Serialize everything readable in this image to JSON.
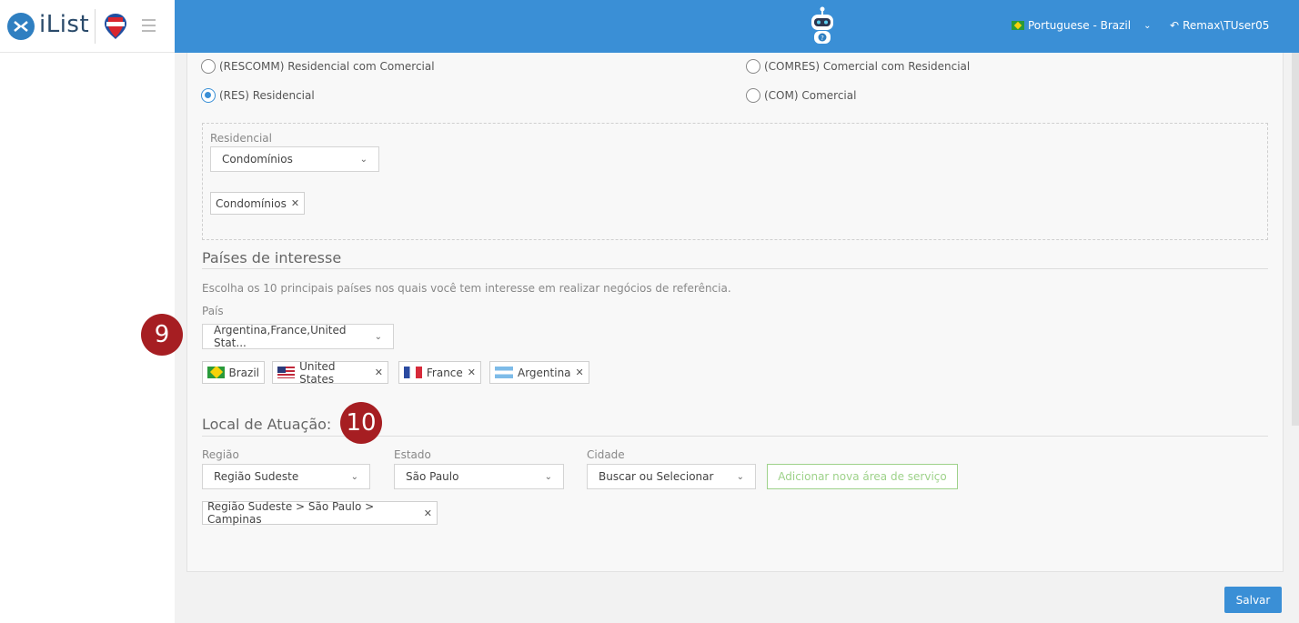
{
  "header": {
    "app_name": "iList",
    "language": "Portuguese - Brazil",
    "user": "Remax\\TUser05"
  },
  "property_types": [
    {
      "label": "(RESCOMM) Residencial com Comercial",
      "checked": false
    },
    {
      "label": "(COMRES) Comercial com Residencial",
      "checked": false
    },
    {
      "label": "(RES) Residencial",
      "checked": true
    },
    {
      "label": "(COM) Comercial",
      "checked": false
    }
  ],
  "residencial": {
    "label": "Residencial",
    "selected": "Condomínios",
    "tags": [
      "Condomínios"
    ]
  },
  "countries": {
    "title": "Países de interesse",
    "hint": "Escolha os 10 principais países nos quais você tem interesse em realizar negócios de referência.",
    "field_label": "País",
    "selected": "Argentina,France,United Stat...",
    "tags": [
      "Brazil",
      "United States",
      "France",
      "Argentina"
    ]
  },
  "location": {
    "title": "Local de Atuação:",
    "region_label": "Região",
    "region_value": "Região Sudeste",
    "state_label": "Estado",
    "state_value": "São Paulo",
    "city_label": "Cidade",
    "city_value": "Buscar ou Selecionar",
    "add_button": "Adicionar nova área de serviço",
    "tags": [
      "Região Sudeste > São Paulo > Campinas"
    ]
  },
  "badges": {
    "countries": "9",
    "location": "10"
  },
  "footer": {
    "save_label": "Salvar"
  },
  "colors": {
    "accent": "#3a8fd6",
    "badge": "#a61e22",
    "add_button": "#9ed28a"
  }
}
